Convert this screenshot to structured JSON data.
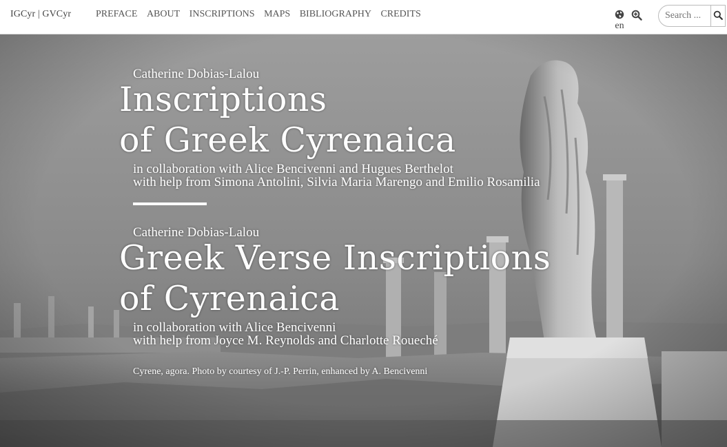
{
  "nav": {
    "brand": "IGCyr | GVCyr",
    "items": [
      {
        "label": "PREFACE"
      },
      {
        "label": "ABOUT"
      },
      {
        "label": "INSCRIPTIONS"
      },
      {
        "label": "MAPS"
      },
      {
        "label": "BIBLIOGRAPHY"
      },
      {
        "label": "CREDITS"
      }
    ],
    "language": "en",
    "search_placeholder": "Search ..."
  },
  "hero": {
    "first": {
      "author": "Catherine Dobias-Lalou",
      "title_line1": "Inscriptions",
      "title_line2": "of Greek Cyrenaica",
      "collab_line1": "in collaboration with Alice Bencivenni and Hugues Berthelot",
      "collab_line2": "with help from Simona Antolini, Silvia Maria Marengo and Emilio Rosamilia"
    },
    "second": {
      "author": "Catherine Dobias-Lalou",
      "title_line1": "Greek Verse Inscriptions",
      "title_line2": "of Cyrenaica",
      "collab_line1": "in collaboration with Alice Bencivenni",
      "collab_line2": "with help from Joyce M. Reynolds and Charlotte Roueché"
    },
    "caption": "Cyrene, agora. Photo by courtesy of J.-P. Perrin, enhanced by A. Bencivenni"
  }
}
